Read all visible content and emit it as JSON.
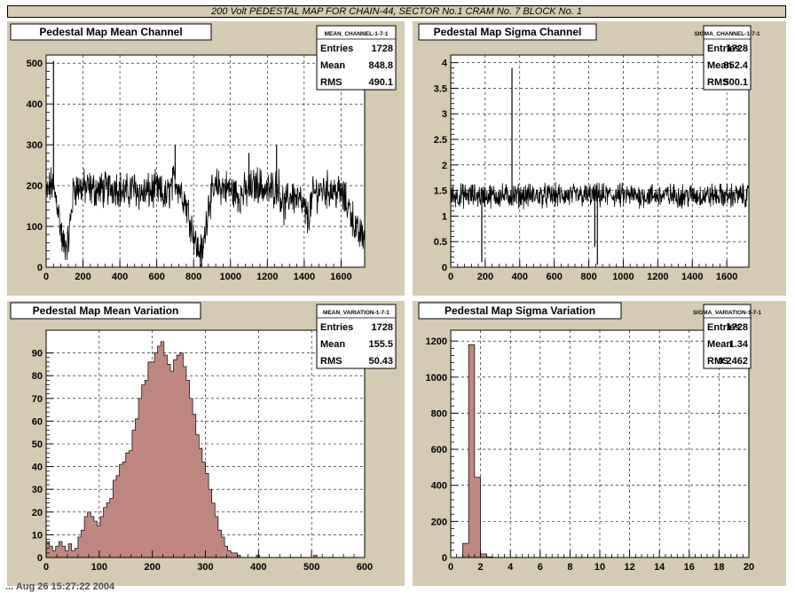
{
  "window": {
    "title": "200 Volt PEDESTAL MAP FOR CHAIN-44, SECTOR No.1 CRAM No. 7 BLOCK No. 1",
    "footer_fragment": "... Aug 26 15:27:22 2004"
  },
  "colors": {
    "pad_background": "#d4cbb2",
    "frame_background": "#ffffff",
    "histogram_fill": "#c08780",
    "line_color": "#000000"
  },
  "chart_data": [
    {
      "id": "mean-channel",
      "type": "line",
      "title": "Pedestal Map Mean Channel",
      "stats": {
        "name": "MEAN_CHANNEL-1-7-1",
        "rows": [
          {
            "label": "Entries",
            "value": "1728"
          },
          {
            "label": "Mean",
            "value": "848.8"
          },
          {
            "label": "RMS",
            "value": "490.1"
          }
        ]
      },
      "xlim": [
        0,
        1728
      ],
      "ylim": [
        0,
        520
      ],
      "xticks": [
        0,
        200,
        400,
        600,
        800,
        1000,
        1200,
        1400,
        1600
      ],
      "yticks": [
        0,
        100,
        200,
        300,
        400,
        500
      ],
      "grid": true,
      "profile": [
        [
          0,
          175
        ],
        [
          30,
          205
        ],
        [
          60,
          160
        ],
        [
          90,
          55
        ],
        [
          120,
          60
        ],
        [
          150,
          195
        ],
        [
          200,
          195
        ],
        [
          260,
          190
        ],
        [
          320,
          190
        ],
        [
          380,
          200
        ],
        [
          430,
          180
        ],
        [
          470,
          195
        ],
        [
          520,
          180
        ],
        [
          560,
          185
        ],
        [
          600,
          190
        ],
        [
          650,
          170
        ],
        [
          700,
          215
        ],
        [
          750,
          170
        ],
        [
          780,
          120
        ],
        [
          820,
          45
        ],
        [
          850,
          35
        ],
        [
          880,
          160
        ],
        [
          930,
          200
        ],
        [
          1000,
          190
        ],
        [
          1050,
          175
        ],
        [
          1100,
          190
        ],
        [
          1150,
          205
        ],
        [
          1200,
          185
        ],
        [
          1260,
          200
        ],
        [
          1290,
          145
        ],
        [
          1330,
          180
        ],
        [
          1380,
          160
        ],
        [
          1420,
          120
        ],
        [
          1450,
          180
        ],
        [
          1500,
          190
        ],
        [
          1550,
          190
        ],
        [
          1600,
          180
        ],
        [
          1650,
          140
        ],
        [
          1690,
          80
        ],
        [
          1728,
          80
        ]
      ],
      "spikes": [
        [
          40,
          505
        ],
        [
          700,
          300
        ],
        [
          1250,
          300
        ],
        [
          1100,
          280
        ]
      ]
    },
    {
      "id": "sigma-channel",
      "type": "line",
      "title": "Pedestal Map Sigma Channel",
      "stats": {
        "name": "SIGMA_CHANNEL-1-7-1",
        "rows": [
          {
            "label": "Entries",
            "value": "1728"
          },
          {
            "label": "Mean",
            "value": "852.4"
          },
          {
            "label": "RMS",
            "value": "500.1"
          }
        ]
      },
      "xlim": [
        0,
        1728
      ],
      "ylim": [
        0,
        4.15
      ],
      "xticks": [
        0,
        200,
        400,
        600,
        800,
        1000,
        1200,
        1400,
        1600
      ],
      "yticks": [
        0,
        0.5,
        1,
        1.5,
        2,
        2.5,
        3,
        3.5,
        4
      ],
      "ytick_labels": [
        "0",
        "0.5",
        "1",
        "1.5",
        "2",
        "2.5",
        "3",
        "3.5",
        "4"
      ],
      "grid": true,
      "profile": [
        [
          0,
          1.4
        ],
        [
          1728,
          1.4
        ]
      ],
      "spikes": [
        [
          355,
          3.9
        ],
        [
          850,
          0.05
        ],
        [
          835,
          0.4
        ],
        [
          180,
          0.1
        ]
      ]
    },
    {
      "id": "mean-variation",
      "type": "bar",
      "title": "Pedestal Map Mean Variation",
      "stats": {
        "name": "MEAN_VARIATION-1-7-1",
        "rows": [
          {
            "label": "Entries",
            "value": "1728"
          },
          {
            "label": "Mean",
            "value": "155.5"
          },
          {
            "label": "RMS",
            "value": "50.43"
          }
        ]
      },
      "xlim": [
        0,
        600
      ],
      "ylim": [
        0,
        100
      ],
      "xticks": [
        0,
        100,
        200,
        300,
        400,
        500,
        600
      ],
      "yticks": [
        0,
        10,
        20,
        30,
        40,
        50,
        60,
        70,
        80,
        90
      ],
      "grid": true,
      "bin_width": 6,
      "x_start": 0,
      "values": [
        7,
        5,
        3,
        5,
        7,
        5,
        3,
        6,
        3,
        4,
        9,
        12,
        18,
        20,
        18,
        16,
        14,
        18,
        22,
        24,
        26,
        34,
        36,
        41,
        42,
        46,
        47,
        56,
        61,
        70,
        76,
        78,
        86,
        86,
        90,
        93,
        95,
        89,
        85,
        82,
        87,
        89,
        90,
        84,
        78,
        70,
        63,
        54,
        48,
        42,
        37,
        30,
        24,
        18,
        12,
        9,
        5,
        3,
        2,
        2,
        1,
        0,
        0,
        0,
        0,
        0,
        1,
        0,
        0,
        0,
        0,
        0,
        0,
        0,
        0,
        0,
        0,
        0,
        0,
        0,
        0,
        0,
        0,
        0,
        1,
        0,
        0,
        0,
        0,
        0,
        0,
        0,
        0,
        0,
        0,
        0,
        0,
        0,
        0,
        0
      ]
    },
    {
      "id": "sigma-variation",
      "type": "bar",
      "title": "Pedestal Map Sigma Variation",
      "stats": {
        "name": "SIGMA_VARIATION-1-7-1",
        "rows": [
          {
            "label": "Entries",
            "value": "1728"
          },
          {
            "label": "Mean",
            "value": "1.34"
          },
          {
            "label": "RMS",
            "value": "0.2462"
          }
        ]
      },
      "xlim": [
        0,
        20
      ],
      "ylim": [
        0,
        1260
      ],
      "xticks": [
        0,
        2,
        4,
        6,
        8,
        10,
        12,
        14,
        16,
        18,
        20
      ],
      "yticks": [
        0,
        200,
        400,
        600,
        800,
        1000,
        1200
      ],
      "grid": true,
      "bin_width": 0.4,
      "x_start": 0,
      "values": [
        0,
        0,
        78,
        1180,
        445,
        20,
        3,
        1,
        0,
        0,
        0,
        1,
        0,
        0,
        0,
        0,
        0,
        0,
        0,
        0,
        0,
        0,
        0,
        0,
        0,
        0,
        0,
        0,
        0,
        0,
        0,
        0,
        0,
        0,
        0,
        0,
        0,
        0,
        0,
        0,
        0,
        0,
        0,
        0,
        0,
        0,
        0,
        0,
        0,
        0
      ]
    }
  ]
}
